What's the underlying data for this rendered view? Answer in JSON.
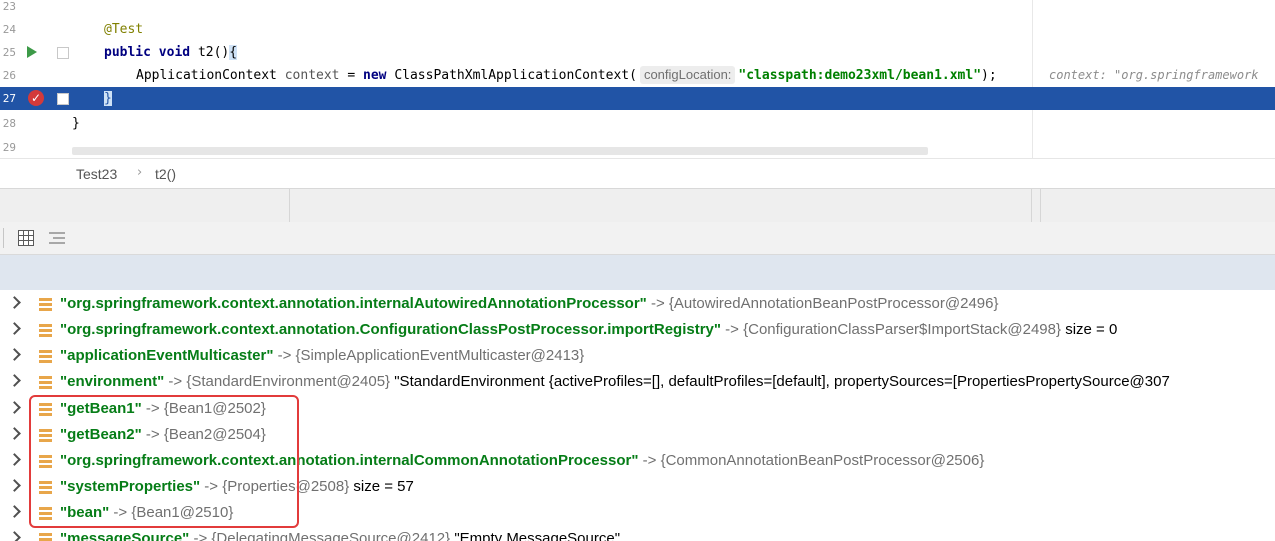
{
  "editor": {
    "lines": [
      {
        "num": "23"
      },
      {
        "num": "24",
        "annotation": "@Test"
      },
      {
        "num": "25",
        "kw1": "public",
        "kw2": "void",
        "method": "t2()",
        "brace": "{"
      },
      {
        "num": "26",
        "type": "ApplicationContext",
        "varname": "context",
        "eq": "=",
        "kw_new": "new",
        "ctor": "ClassPathXmlApplicationContext(",
        "hint": "configLocation:",
        "string": "\"classpath:demo23xml/bean1.xml\"",
        "end": ");",
        "inline_value": "context: \"org.springframework"
      },
      {
        "num": "27",
        "brace": "}"
      },
      {
        "num": "28",
        "brace": "}"
      },
      {
        "num": "29"
      }
    ]
  },
  "breadcrumb": {
    "class_name": "Test23",
    "separator": "›",
    "method_name": "t2()"
  },
  "variables": [
    {
      "key": "\"org.springframework.context.annotation.internalAutowiredAnnotationProcessor\"",
      "arrow": "->",
      "ref": "{AutowiredAnnotationBeanPostProcessor@2496}",
      "value": ""
    },
    {
      "key": "\"org.springframework.context.annotation.ConfigurationClassPostProcessor.importRegistry\"",
      "arrow": "->",
      "ref": "{ConfigurationClassParser$ImportStack@2498}",
      "value": "size = 0"
    },
    {
      "key": "\"applicationEventMulticaster\"",
      "arrow": "->",
      "ref": "{SimpleApplicationEventMulticaster@2413}",
      "value": ""
    },
    {
      "key": "\"environment\"",
      "arrow": "->",
      "ref": "{StandardEnvironment@2405}",
      "value": "\"StandardEnvironment {activeProfiles=[], defaultProfiles=[default], propertySources=[PropertiesPropertySource@307"
    },
    {
      "key": "\"getBean1\"",
      "arrow": "->",
      "ref": "{Bean1@2502}",
      "value": ""
    },
    {
      "key": "\"getBean2\"",
      "arrow": "->",
      "ref": "{Bean2@2504}",
      "value": ""
    },
    {
      "key": "\"org.springframework.context.annotation.internalCommonAnnotationProcessor\"",
      "arrow": "->",
      "ref": "{CommonAnnotationBeanPostProcessor@2506}",
      "value": ""
    },
    {
      "key": "\"systemProperties\"",
      "arrow": "->",
      "ref": "{Properties@2508}",
      "value": "size = 57"
    },
    {
      "key": "\"bean\"",
      "arrow": "->",
      "ref": "{Bean1@2510}",
      "value": ""
    },
    {
      "key": "\"messageSource\"",
      "arrow": "->",
      "ref": "{DelegatingMessageSource@2412}",
      "value": "\"Empty MessageSource\""
    }
  ],
  "colors": {
    "accent_selection": "#2154a6",
    "string_key": "#067d17",
    "annotation_box": "#e23b3b",
    "run_icon": "#3d9a48",
    "breakpoint": "#d33a3a"
  },
  "icons": {
    "run": "run-gutter-icon",
    "breakpoint": "breakpoint-icon",
    "table_view": "table-view-icon",
    "list_view": "list-view-icon",
    "entry": "map-entry-icon",
    "expand": "chevron-right-icon"
  }
}
